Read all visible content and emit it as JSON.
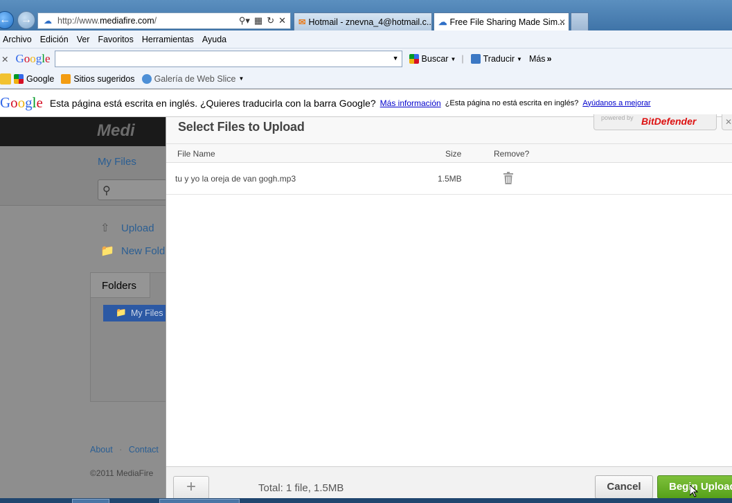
{
  "browser": {
    "address_url_prefix": "http://www.",
    "address_url_domain": "mediafire.com",
    "address_url_suffix": "/",
    "tabs": [
      {
        "label": "Hotmail - znevna_4@hotmail.c..."
      },
      {
        "label": "Free File Sharing Made Sim..."
      }
    ],
    "menu": [
      "Archivo",
      "Edición",
      "Ver",
      "Favoritos",
      "Herramientas",
      "Ayuda"
    ],
    "google_toolbar": {
      "search_value": "",
      "buscar_label": "Buscar",
      "traducir_label": "Traducir",
      "mas_label": "Más"
    },
    "favorites": [
      {
        "label": "Google"
      },
      {
        "label": "Sitios sugeridos"
      },
      {
        "label": "Galería de Web Slice"
      }
    ],
    "translate_bar": {
      "message": "Esta página está escrita en inglés. ¿Quieres traducirla con la barra Google?",
      "more_info_link": "Más información",
      "question": "¿Esta página no está escrita en inglés?",
      "improve_link": "Ayúdanos a mejorar"
    }
  },
  "page": {
    "logo_text": "Medi",
    "my_files_link": "My Files",
    "upload_label": "Upload",
    "new_folder_label": "New Fold",
    "folders_tab": "Folders",
    "folder_item": "My Files",
    "footer_about": "About",
    "footer_contact": "Contact",
    "copyright": "©2011 MediaFire"
  },
  "modal": {
    "title": "Select Files to Upload",
    "badge_powered": "powered by",
    "badge_brand": "BitDefender",
    "columns": {
      "name": "File Name",
      "size": "Size",
      "remove": "Remove?"
    },
    "files": [
      {
        "name": "tu y yo la oreja de van gogh.mp3",
        "size": "1.5MB"
      }
    ],
    "total_text": "Total: 1 file, 1.5MB",
    "cancel_label": "Cancel",
    "begin_label": "Begin Upload"
  },
  "colors": {
    "accent_green": "#6ab22e",
    "link_blue": "#2a5e93",
    "folder_selected": "#2c59a4"
  }
}
